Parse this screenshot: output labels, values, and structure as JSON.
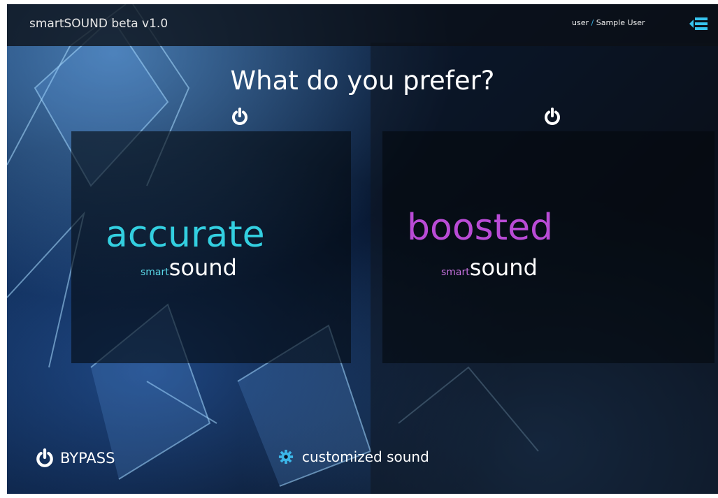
{
  "window": {
    "title": "smartSOUND beta v1.0",
    "user_prefix": "user",
    "user_separator": "/",
    "user_name": "Sample User",
    "menu_icon": "hamburger-menu-icon"
  },
  "heading": "What do you prefer?",
  "modes": [
    {
      "title": "accurate",
      "sub_small": "smart",
      "sub_large": "sound",
      "icon": "power-icon",
      "color": "#33cfe0"
    },
    {
      "title": "boosted",
      "sub_small": "smart",
      "sub_large": "sound",
      "icon": "power-icon",
      "color": "#b94bd6"
    }
  ],
  "footer": {
    "bypass_label": "BYPASS",
    "bypass_icon": "power-icon",
    "custom_label": "customized sound",
    "custom_icon": "gear-icon",
    "accent": "#3bb6e8"
  }
}
